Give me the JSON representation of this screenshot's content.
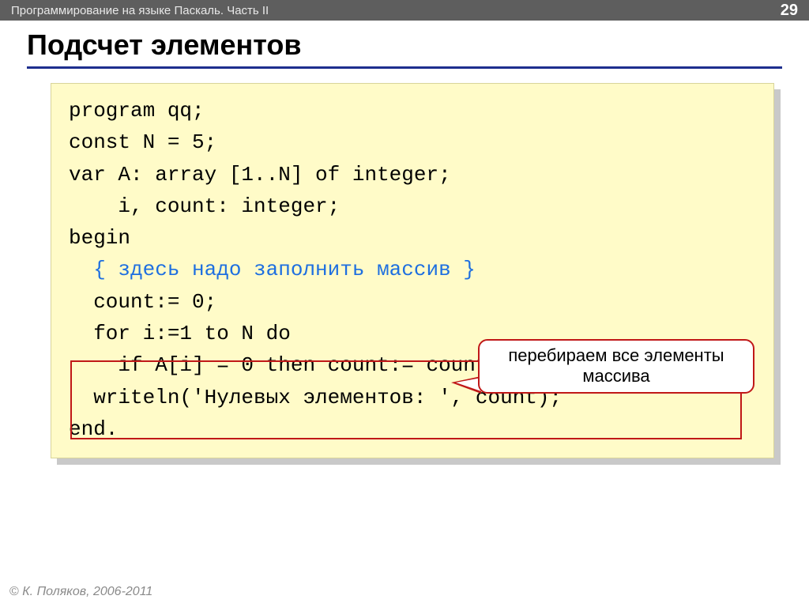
{
  "header": {
    "subtitle": "Программирование на языке Паскаль. Часть II",
    "page_number": "29"
  },
  "title": "Подсчет элементов",
  "code": {
    "l1": "program qq;",
    "l2": "const N = 5;",
    "l3": "var A: array [1..N] of integer;",
    "l4": "    i, count: integer;",
    "l5": "begin",
    "l6": "  { здесь надо заполнить массив }",
    "l7": "  count:= 0;",
    "l8": "  for i:=1 to N do",
    "l9": "    if A[i] = 0 then count:= count + 1;",
    "l10": "  writeln('Нулевых элементов: ', count);",
    "l11": "end."
  },
  "callout": "перебираем все элементы массива",
  "footer": {
    "copy": "©",
    "text": " К. Поляков, 2006-2011"
  }
}
